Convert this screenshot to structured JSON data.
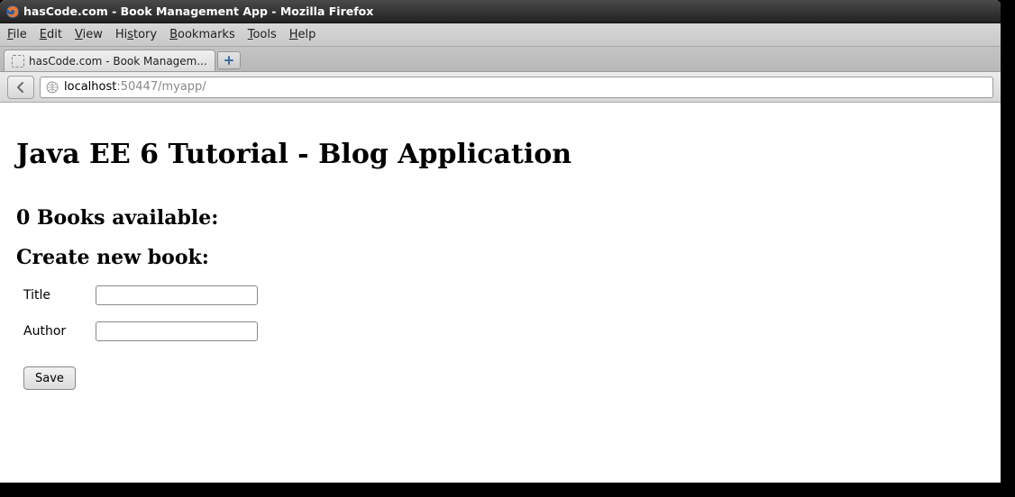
{
  "window": {
    "title": "hasCode.com - Book Management App - Mozilla Firefox"
  },
  "menubar": {
    "items": [
      "File",
      "Edit",
      "View",
      "History",
      "Bookmarks",
      "Tools",
      "Help"
    ]
  },
  "tabs": {
    "active_label": "hasCode.com - Book Managem..."
  },
  "url": {
    "host": "localhost",
    "rest": ":50447/myapp/"
  },
  "page": {
    "h1": "Java EE 6 Tutorial - Blog Application",
    "h2_books": "0 Books available:",
    "h2_create": "Create new book:",
    "form": {
      "title_label": "Title",
      "author_label": "Author",
      "title_value": "",
      "author_value": "",
      "save_label": "Save"
    }
  }
}
